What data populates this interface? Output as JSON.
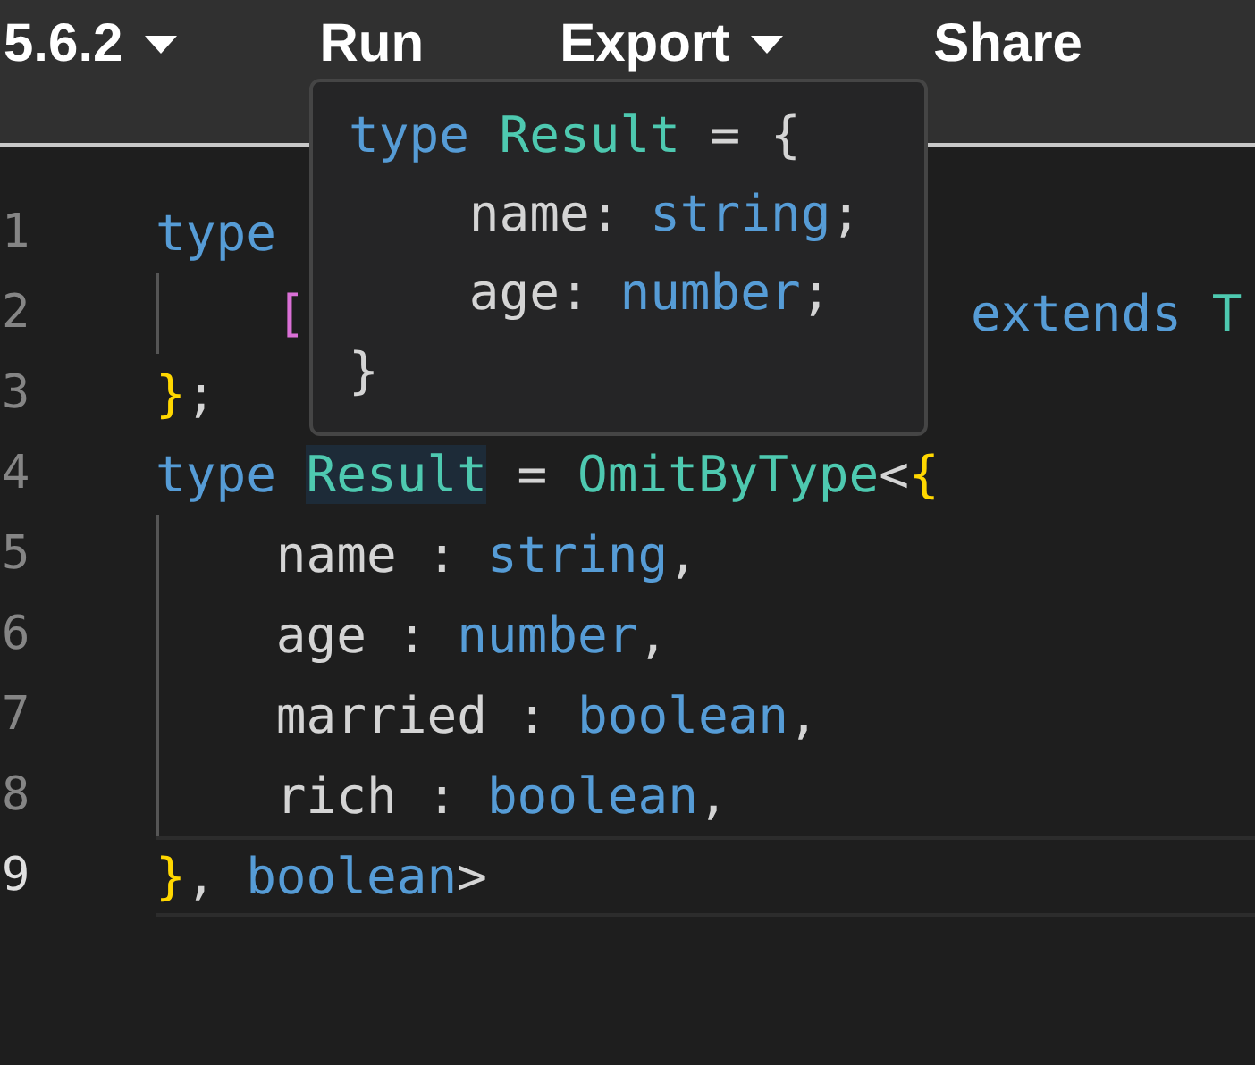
{
  "toolbar": [
    {
      "label": "5.6.2",
      "dropdown": true
    },
    {
      "label": "Run",
      "dropdown": false
    },
    {
      "label": "Export",
      "dropdown": true
    },
    {
      "label": "Share",
      "dropdown": false
    }
  ],
  "editor": {
    "lines": [
      {
        "number": "1",
        "active": false,
        "indent_guide": false,
        "tokens": [
          {
            "text": "type",
            "kind": "keyword",
            "highlighted": false
          }
        ]
      },
      {
        "number": "2",
        "active": false,
        "indent_guide": true,
        "tokens": [
          {
            "text": "    [",
            "kind": "bracket",
            "highlighted": false
          }
        ],
        "tail_tokens": [
          {
            "text": "extends ",
            "kind": "keyword",
            "highlighted": false
          },
          {
            "text": "T",
            "kind": "type",
            "highlighted": false
          }
        ]
      },
      {
        "number": "3",
        "active": false,
        "indent_guide": false,
        "tokens": [
          {
            "text": "}",
            "kind": "brace",
            "highlighted": false
          },
          {
            "text": ";",
            "kind": "plain",
            "highlighted": false
          }
        ]
      },
      {
        "number": "4",
        "active": false,
        "indent_guide": false,
        "tokens": [
          {
            "text": "type ",
            "kind": "keyword",
            "highlighted": false
          },
          {
            "text": "Result",
            "kind": "type",
            "highlighted": true
          },
          {
            "text": " = ",
            "kind": "plain",
            "highlighted": false
          },
          {
            "text": "OmitByType",
            "kind": "type",
            "highlighted": false
          },
          {
            "text": "<",
            "kind": "plain",
            "highlighted": false
          },
          {
            "text": "{",
            "kind": "brace",
            "highlighted": false
          }
        ]
      },
      {
        "number": "5",
        "active": false,
        "indent_guide": true,
        "tokens": [
          {
            "text": "    name : ",
            "kind": "plain",
            "highlighted": false
          },
          {
            "text": "string",
            "kind": "keyword",
            "highlighted": false
          },
          {
            "text": ",",
            "kind": "plain",
            "highlighted": false
          }
        ]
      },
      {
        "number": "6",
        "active": false,
        "indent_guide": true,
        "tokens": [
          {
            "text": "    age : ",
            "kind": "plain",
            "highlighted": false
          },
          {
            "text": "number",
            "kind": "keyword",
            "highlighted": false
          },
          {
            "text": ",",
            "kind": "plain",
            "highlighted": false
          }
        ]
      },
      {
        "number": "7",
        "active": false,
        "indent_guide": true,
        "tokens": [
          {
            "text": "    married : ",
            "kind": "plain",
            "highlighted": false
          },
          {
            "text": "boolean",
            "kind": "keyword",
            "highlighted": false
          },
          {
            "text": ",",
            "kind": "plain",
            "highlighted": false
          }
        ]
      },
      {
        "number": "8",
        "active": false,
        "indent_guide": true,
        "tokens": [
          {
            "text": "    rich : ",
            "kind": "plain",
            "highlighted": false
          },
          {
            "text": "boolean",
            "kind": "keyword",
            "highlighted": false
          },
          {
            "text": ",",
            "kind": "plain",
            "highlighted": false
          }
        ]
      },
      {
        "number": "9",
        "active": true,
        "indent_guide": false,
        "tokens": [
          {
            "text": "}",
            "kind": "brace",
            "highlighted": false
          },
          {
            "text": ", ",
            "kind": "plain",
            "highlighted": false
          },
          {
            "text": "boolean",
            "kind": "keyword",
            "highlighted": false
          },
          {
            "text": ">",
            "kind": "plain",
            "highlighted": false
          }
        ]
      }
    ]
  },
  "tooltip": {
    "lines": [
      {
        "tokens": [
          {
            "text": "type ",
            "kind": "keyword"
          },
          {
            "text": "Result",
            "kind": "type"
          },
          {
            "text": " = {",
            "kind": "plain"
          }
        ]
      },
      {
        "tokens": [
          {
            "text": "    name: ",
            "kind": "plain"
          },
          {
            "text": "string",
            "kind": "keyword"
          },
          {
            "text": ";",
            "kind": "plain"
          }
        ]
      },
      {
        "tokens": [
          {
            "text": "    age: ",
            "kind": "plain"
          },
          {
            "text": "number",
            "kind": "keyword"
          },
          {
            "text": ";",
            "kind": "plain"
          }
        ]
      },
      {
        "tokens": [
          {
            "text": "}",
            "kind": "plain"
          }
        ]
      }
    ]
  }
}
